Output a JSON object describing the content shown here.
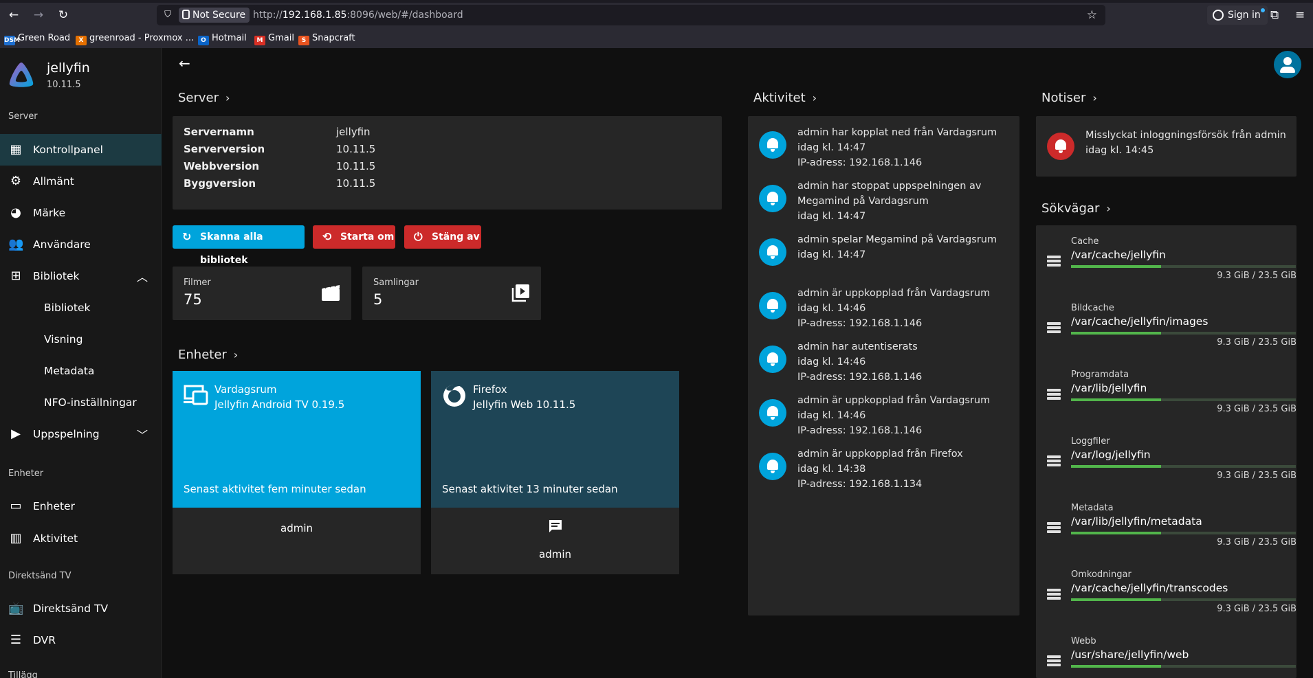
{
  "browser": {
    "security_label": "Not Secure",
    "url_scheme": "http://",
    "url_host": "192.168.1.85",
    "url_rest": ":8096/web/#/dashboard",
    "signin_label": "Sign in",
    "bookmarks": [
      {
        "label": "Green Road",
        "icon": "dsm-icon",
        "color": "#1d6fd1",
        "glyph": "DSM"
      },
      {
        "label": "greenroad - Proxmox ...",
        "icon": "proxmox-icon",
        "color": "#e57000",
        "glyph": "X"
      },
      {
        "label": "Hotmail",
        "icon": "outlook-icon",
        "color": "#0a64c8",
        "glyph": "O"
      },
      {
        "label": "Gmail",
        "icon": "gmail-icon",
        "color": "#d93025",
        "glyph": "M"
      },
      {
        "label": "Snapcraft",
        "icon": "snapcraft-icon",
        "color": "#e95420",
        "glyph": "S"
      }
    ]
  },
  "app": {
    "name": "jellyfin",
    "version": "10.11.5"
  },
  "sidebar": {
    "sections": {
      "server": "Server",
      "devices": "Enheter",
      "livetv": "Direktsänd TV",
      "plugins": "Tillägg"
    },
    "items": {
      "kontrollpanel": "Kontrollpanel",
      "allmant": "Allmänt",
      "marke": "Märke",
      "anvandare": "Användare",
      "bibliotek": "Bibliotek",
      "bibliotek_sub": "Bibliotek",
      "visning": "Visning",
      "metadata": "Metadata",
      "nfo": "NFO-inställningar",
      "uppspelning": "Uppspelning",
      "enheter": "Enheter",
      "aktivitet": "Aktivitet",
      "livetv": "Direktsänd TV",
      "dvr": "DVR"
    }
  },
  "server": {
    "heading": "Server",
    "rows": [
      {
        "key": "Servernamn",
        "value": "jellyfin"
      },
      {
        "key": "Serverversion",
        "value": "10.11.5"
      },
      {
        "key": "Webbversion",
        "value": "10.11.5"
      },
      {
        "key": "Byggversion",
        "value": "10.11.5"
      }
    ],
    "buttons": {
      "scan": "Skanna alla bibliotek",
      "restart": "Starta om",
      "shutdown": "Stäng av"
    },
    "stats": [
      {
        "label": "Filmer",
        "value": "75"
      },
      {
        "label": "Samlingar",
        "value": "5"
      }
    ]
  },
  "devices": {
    "heading": "Enheter",
    "cards": [
      {
        "name": "Vardagsrum",
        "app": "Jellyfin Android TV 0.19.5",
        "last_active": "Senast aktivitet fem minuter sedan",
        "user": "admin",
        "color": "#00a4dc"
      },
      {
        "name": "Firefox",
        "app": "Jellyfin Web 10.11.5",
        "last_active": "Senast aktivitet 13 minuter sedan",
        "user": "admin",
        "color": "#1e4556"
      }
    ]
  },
  "activity": {
    "heading": "Aktivitet",
    "items": [
      {
        "line1": "admin har kopplat ned från Vardagsrum",
        "line2": "idag kl. 14:47",
        "line3": "IP-adress: 192.168.1.146"
      },
      {
        "line1": "admin har stoppat uppspelningen av",
        "line2": "Megamind på Vardagsrum",
        "line3": "idag kl. 14:47"
      },
      {
        "line1": "admin spelar Megamind på Vardagsrum",
        "line2": "idag kl. 14:47",
        "line3": ""
      },
      {
        "line1": "admin är uppkopplad från Vardagsrum",
        "line2": "idag kl. 14:46",
        "line3": "IP-adress: 192.168.1.146"
      },
      {
        "line1": "admin har autentiserats",
        "line2": "idag kl. 14:46",
        "line3": "IP-adress: 192.168.1.146"
      },
      {
        "line1": "admin är uppkopplad från Vardagsrum",
        "line2": "idag kl. 14:46",
        "line3": "IP-adress: 192.168.1.146"
      },
      {
        "line1": "admin är uppkopplad från Firefox",
        "line2": "idag kl. 14:38",
        "line3": "IP-adress: 192.168.1.134"
      }
    ]
  },
  "alerts": {
    "heading": "Notiser",
    "item": {
      "line1": "Misslyckat inloggningsförsök från admin",
      "line2": "idag kl. 14:45"
    }
  },
  "paths": {
    "heading": "Sökvägar",
    "usage_fraction": 0.4,
    "items": [
      {
        "label": "Cache",
        "path": "/var/cache/jellyfin",
        "usage": "9.3 GiB / 23.5 GiB"
      },
      {
        "label": "Bildcache",
        "path": "/var/cache/jellyfin/images",
        "usage": "9.3 GiB / 23.5 GiB"
      },
      {
        "label": "Programdata",
        "path": "/var/lib/jellyfin",
        "usage": "9.3 GiB / 23.5 GiB"
      },
      {
        "label": "Loggfiler",
        "path": "/var/log/jellyfin",
        "usage": "9.3 GiB / 23.5 GiB"
      },
      {
        "label": "Metadata",
        "path": "/var/lib/jellyfin/metadata",
        "usage": "9.3 GiB / 23.5 GiB"
      },
      {
        "label": "Omkodningar",
        "path": "/var/cache/jellyfin/transcodes",
        "usage": "9.3 GiB / 23.5 GiB"
      },
      {
        "label": "Webb",
        "path": "/usr/share/jellyfin/web",
        "usage": ""
      }
    ]
  },
  "colors": {
    "accent": "#00a4dc",
    "danger": "#cc2a2a",
    "bar": "#52b54b"
  }
}
